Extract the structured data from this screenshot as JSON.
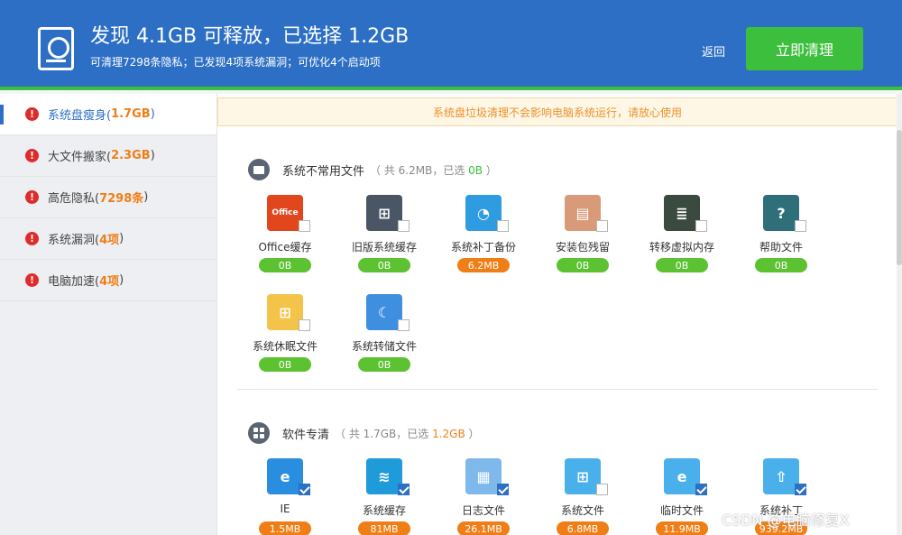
{
  "header": {
    "title": "发现 4.1GB 可释放，已选择 1.2GB",
    "subtitle": "可清理7298条隐私；已发现4项系统漏洞；可优化4个启动项",
    "back_label": "返回",
    "clean_label": "立即清理"
  },
  "sidebar": {
    "items": [
      {
        "label": "系统盘瘦身(",
        "amount": "1.7GB",
        "close": ")",
        "active": true
      },
      {
        "label": "大文件搬家(",
        "amount": "2.3GB",
        "close": ")",
        "active": false
      },
      {
        "label": "高危隐私(",
        "amount": "7298条",
        "close": ")",
        "active": false
      },
      {
        "label": "系统漏洞(",
        "amount": "4项",
        "close": ")",
        "active": false
      },
      {
        "label": "电脑加速(",
        "amount": "4项",
        "close": ")",
        "active": false
      }
    ]
  },
  "notice": "系统盘垃圾清理不会影响电脑系统运行，请放心使用",
  "sections": [
    {
      "title": "系统不常用文件",
      "meta_prefix": "（ 共 6.2MB，已选 ",
      "meta_selected": "0B",
      "meta_suffix": " ）",
      "items": [
        {
          "label": "Office缓存",
          "size": "0B",
          "checked": false,
          "icon": "office-icon",
          "color": "#e2461c",
          "glyph": "Office"
        },
        {
          "label": "旧版系统缓存",
          "size": "0B",
          "checked": false,
          "icon": "old-system-icon",
          "color": "#4a5566",
          "glyph": "⊞"
        },
        {
          "label": "系统补丁备份",
          "size": "6.2MB",
          "checked": false,
          "icon": "patch-backup-icon",
          "color": "#2f9be0",
          "glyph": "◔"
        },
        {
          "label": "安装包残留",
          "size": "0B",
          "checked": false,
          "icon": "package-icon",
          "color": "#d99a7a",
          "glyph": "▤"
        },
        {
          "label": "转移虚拟内存",
          "size": "0B",
          "checked": false,
          "icon": "memory-icon",
          "color": "#3a4a3f",
          "glyph": "≣"
        },
        {
          "label": "帮助文件",
          "size": "0B",
          "checked": false,
          "icon": "help-icon",
          "color": "#2f6f7a",
          "glyph": "?"
        },
        {
          "label": "系统休眠文件",
          "size": "0B",
          "checked": false,
          "icon": "hibernate-icon",
          "color": "#f3c34a",
          "glyph": "⊞"
        },
        {
          "label": "系统转储文件",
          "size": "0B",
          "checked": false,
          "icon": "dump-icon",
          "color": "#3f8fe0",
          "glyph": "☾"
        }
      ]
    },
    {
      "title": "软件专清",
      "meta_prefix": "（ 共 1.7GB，已选 ",
      "meta_selected": "1.2GB",
      "meta_suffix": " ）",
      "items": [
        {
          "label": "IE",
          "size": "1.5MB",
          "checked": true,
          "icon": "ie-icon",
          "color": "#2a8ee0",
          "glyph": "e"
        },
        {
          "label": "系统缓存",
          "size": "81MB",
          "checked": true,
          "icon": "system-cache-icon",
          "color": "#1e9bd8",
          "glyph": "≋"
        },
        {
          "label": "日志文件",
          "size": "26.1MB",
          "checked": true,
          "icon": "log-file-icon",
          "color": "#7fb8ea",
          "glyph": "▦"
        },
        {
          "label": "系统文件",
          "size": "6.8MB",
          "checked": false,
          "icon": "system-folder-icon",
          "color": "#4ab0ec",
          "glyph": "⊞"
        },
        {
          "label": "临时文件",
          "size": "11.9MB",
          "checked": true,
          "icon": "temp-folder-icon",
          "color": "#4ab0ec",
          "glyph": "e"
        },
        {
          "label": "系统补丁",
          "size": "939.2MB",
          "checked": true,
          "icon": "patch-folder-icon",
          "color": "#4ab0ec",
          "glyph": "⇧"
        }
      ]
    }
  ],
  "watermark": "CSDN @电脑修复X"
}
